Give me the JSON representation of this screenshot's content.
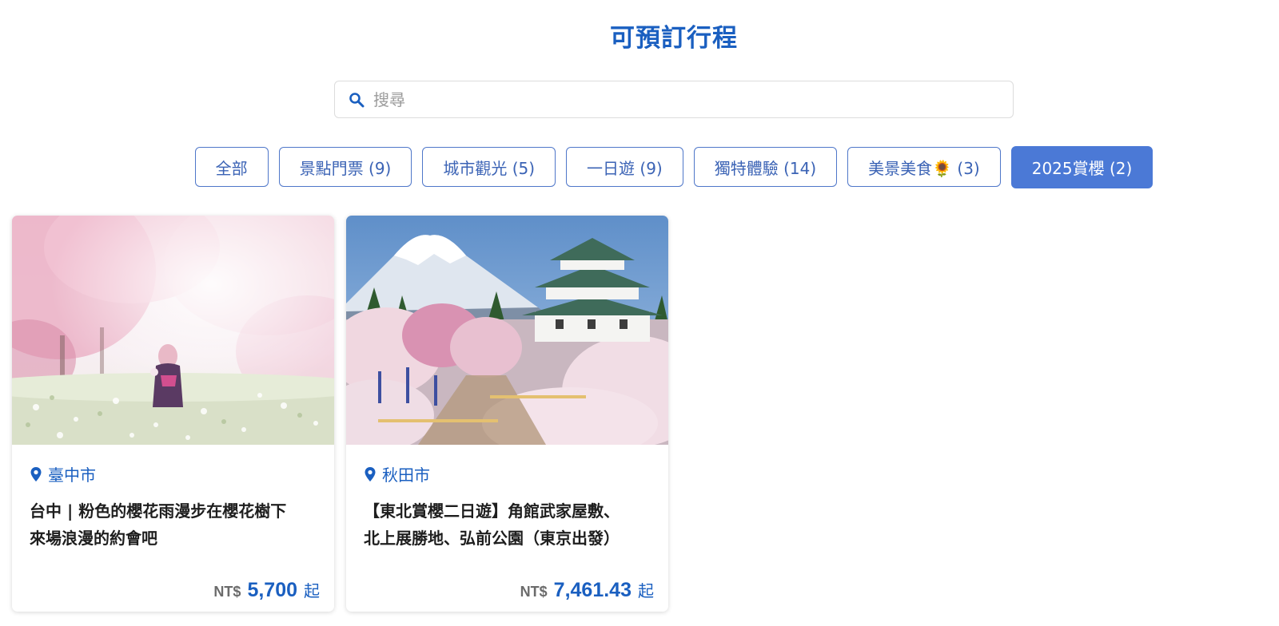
{
  "page": {
    "title": "可預訂行程"
  },
  "search": {
    "placeholder": "搜尋",
    "value": ""
  },
  "filters": [
    {
      "label": "全部",
      "active": false
    },
    {
      "label": "景點門票 (9)",
      "active": false
    },
    {
      "label": "城市觀光 (5)",
      "active": false
    },
    {
      "label": "一日遊 (9)",
      "active": false
    },
    {
      "label": "獨特體驗 (14)",
      "active": false
    },
    {
      "label": "美景美食🌻 (3)",
      "active": false
    },
    {
      "label": "2025賞櫻 (2)",
      "active": true
    }
  ],
  "cards": [
    {
      "location": "臺中市",
      "title_line1": "台中 | 粉色的櫻花雨漫步在櫻花樹下",
      "title_line2": "來場浪漫的約會吧",
      "currency": "NT$",
      "price": "5,700",
      "price_suffix": "起"
    },
    {
      "location": "秋田市",
      "title_line1": "【東北賞櫻二日遊】角館武家屋敷、",
      "title_line2": "北上展勝地、弘前公園（東京出發）",
      "currency": "NT$",
      "price": "7,461.43",
      "price_suffix": "起"
    }
  ],
  "colors": {
    "accent": "#1a5fc0",
    "active_filter": "#4b79d6",
    "filter_border": "#4f77c9"
  },
  "icons": {
    "search": "search-icon",
    "location": "map-pin-icon"
  }
}
